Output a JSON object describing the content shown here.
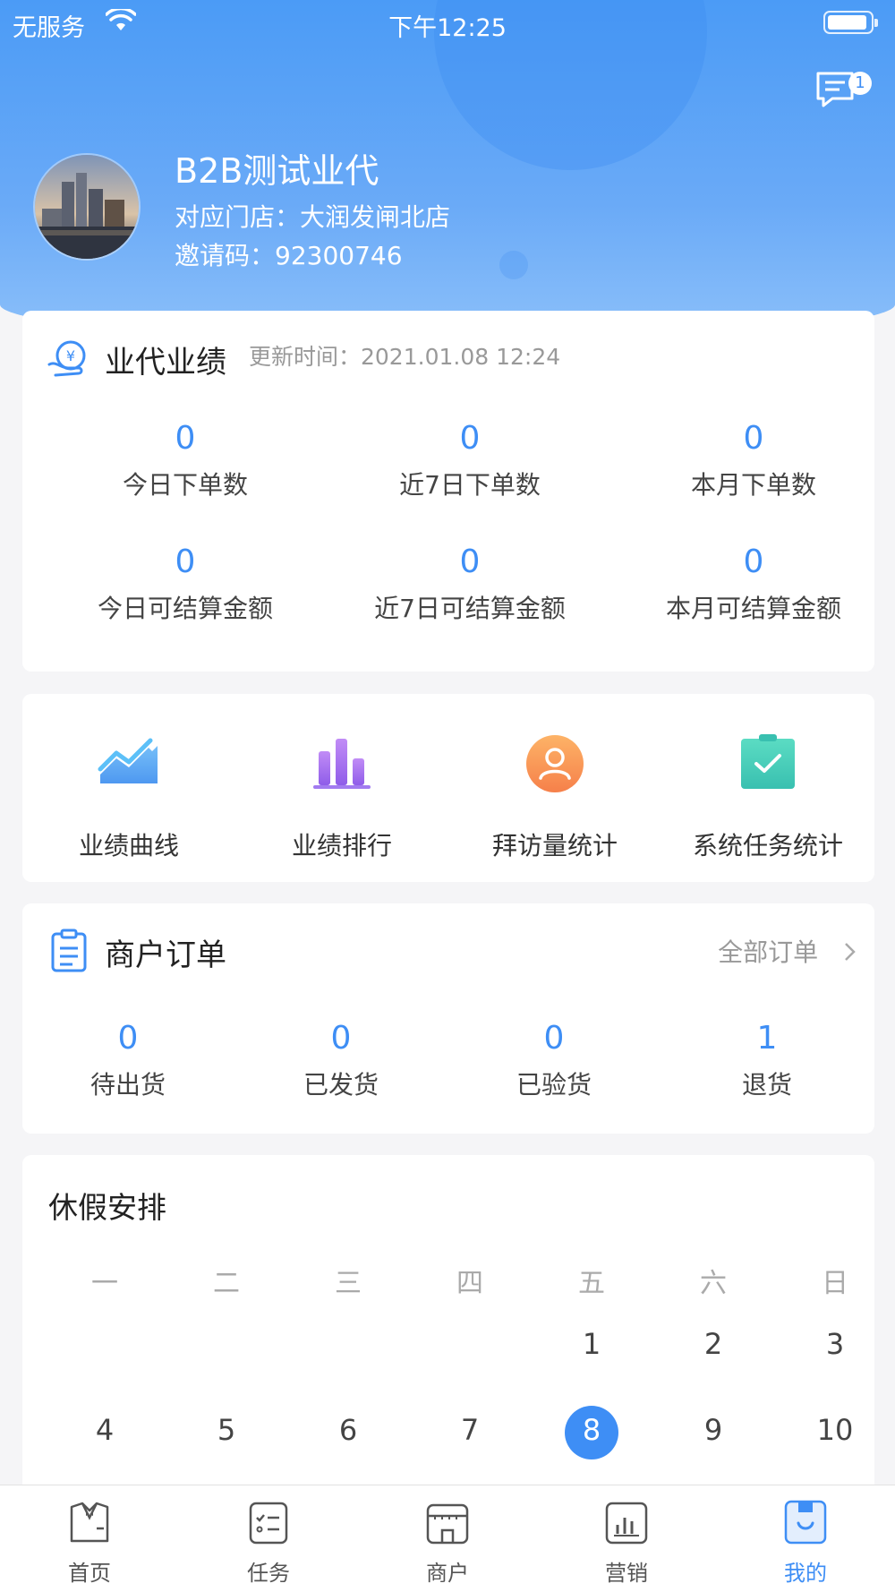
{
  "status_bar": {
    "carrier": "无服务",
    "time": "下午12:25"
  },
  "header": {
    "message_badge": "1",
    "name": "B2B测试业代",
    "store": "对应门店：大润发闸北店",
    "invite_code": "邀请码：92300746"
  },
  "performance": {
    "title": "业代业绩",
    "update_time": "更新时间：2021.01.08 12:24",
    "stats": [
      {
        "value": "0",
        "label": "今日下单数"
      },
      {
        "value": "0",
        "label": "近7日下单数"
      },
      {
        "value": "0",
        "label": "本月下单数"
      },
      {
        "value": "0",
        "label": "今日可结算金额"
      },
      {
        "value": "0",
        "label": "近7日可结算金额"
      },
      {
        "value": "0",
        "label": "本月可结算金额"
      }
    ]
  },
  "tools": [
    {
      "label": "业绩曲线",
      "icon": "trend-chart-icon"
    },
    {
      "label": "业绩排行",
      "icon": "bar-ranking-icon"
    },
    {
      "label": "拜访量统计",
      "icon": "person-icon"
    },
    {
      "label": "系统任务统计",
      "icon": "clipboard-check-icon"
    }
  ],
  "orders": {
    "title": "商户订单",
    "all_link": "全部订单",
    "items": [
      {
        "value": "0",
        "label": "待出货"
      },
      {
        "value": "0",
        "label": "已发货"
      },
      {
        "value": "0",
        "label": "已验货"
      },
      {
        "value": "1",
        "label": "退货"
      }
    ]
  },
  "vacation": {
    "title": "休假安排",
    "weekdays": [
      "一",
      "二",
      "三",
      "四",
      "五",
      "六",
      "日"
    ],
    "row1": [
      "1",
      "2",
      "3"
    ],
    "row2": [
      "4",
      "5",
      "6",
      "7",
      "8",
      "9",
      "10"
    ],
    "selected_day": "8"
  },
  "tabbar": [
    {
      "label": "首页",
      "icon": "home-suit-icon"
    },
    {
      "label": "任务",
      "icon": "task-list-icon"
    },
    {
      "label": "商户",
      "icon": "store-icon"
    },
    {
      "label": "营销",
      "icon": "marketing-chart-icon"
    },
    {
      "label": "我的",
      "icon": "profile-bag-icon",
      "active": true
    }
  ],
  "colors": {
    "accent": "#3e8ef5",
    "header_gradient_top": "#4b9bf6",
    "header_gradient_bottom": "#8cc0fa"
  }
}
